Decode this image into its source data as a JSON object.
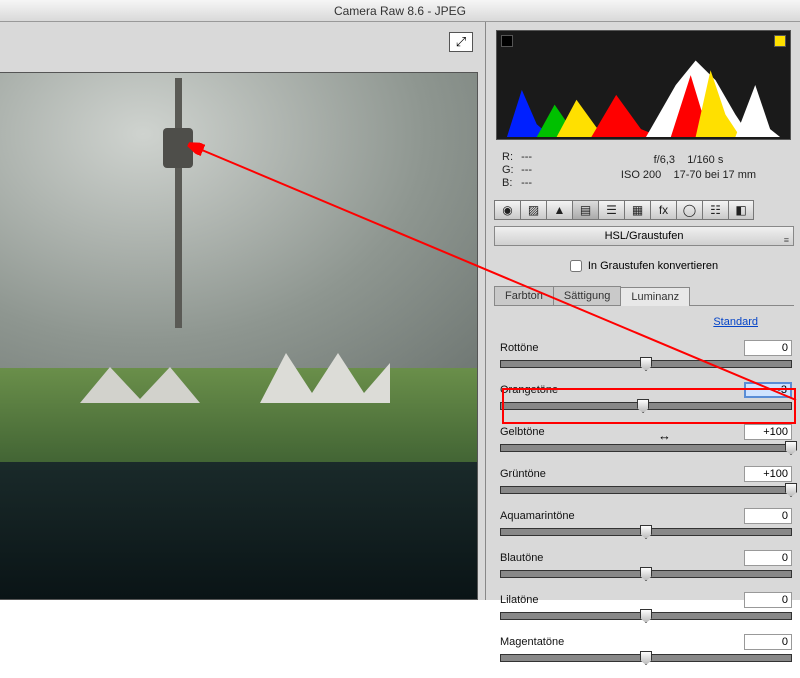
{
  "window": {
    "title": "Camera Raw 8.6 - JPEG"
  },
  "preview": {
    "fullscreen_icon": "⤢"
  },
  "histogram": {
    "clip_shadow": "▲",
    "clip_highlight": "▲"
  },
  "metadata": {
    "r_label": "R:",
    "g_label": "G:",
    "b_label": "B:",
    "r_value": "---",
    "g_value": "---",
    "b_value": "---",
    "aperture": "f/6,3",
    "shutter": "1/160 s",
    "iso": "ISO 200",
    "lens": "17-70 bei 17 mm"
  },
  "tool_icons": [
    "◉",
    "▨",
    "▲",
    "▤",
    "☰",
    "▦",
    "fx",
    "◯",
    "☷",
    "◧"
  ],
  "panel": {
    "title": "HSL/Graustufen",
    "menu": "≡",
    "convert_label": "In Graustufen konvertieren"
  },
  "sub_tabs": {
    "hue": "Farbton",
    "saturation": "Sättigung",
    "luminance": "Luminanz"
  },
  "standard_link": "Standard",
  "sliders": [
    {
      "label": "Rottöne",
      "value": "0",
      "handle_pct": 50,
      "grad": "grad-red",
      "focus": false
    },
    {
      "label": "Orangetöne",
      "value": "-3",
      "handle_pct": 49,
      "grad": "grad-orange",
      "focus": true
    },
    {
      "label": "Gelbtöne",
      "value": "+100",
      "handle_pct": 100,
      "grad": "grad-yellow",
      "focus": false
    },
    {
      "label": "Grüntöne",
      "value": "+100",
      "handle_pct": 100,
      "grad": "grad-green",
      "focus": false
    },
    {
      "label": "Aquamarintöne",
      "value": "0",
      "handle_pct": 50,
      "grad": "grad-aqua",
      "focus": false
    },
    {
      "label": "Blautöne",
      "value": "0",
      "handle_pct": 50,
      "grad": "grad-blue",
      "focus": false
    },
    {
      "label": "Lilatöne",
      "value": "0",
      "handle_pct": 50,
      "grad": "grad-purple",
      "focus": false
    },
    {
      "label": "Magentatöne",
      "value": "0",
      "handle_pct": 50,
      "grad": "grad-magenta",
      "focus": false
    }
  ]
}
